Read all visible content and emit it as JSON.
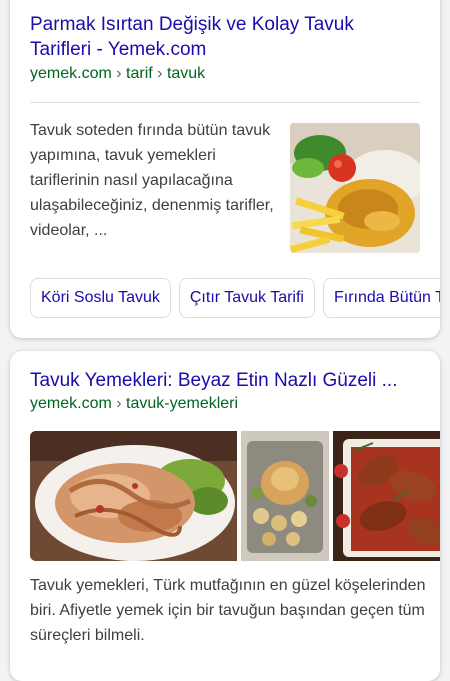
{
  "results": [
    {
      "title": "Parmak Isırtan Değişik ve Kolay Tavuk Tarifleri - Yemek.com",
      "url": {
        "domain": "yemek.com",
        "path1": "tarif",
        "path2": "tavuk"
      },
      "snippet": "Tavuk soteden fırında bütün tavuk yapımına, tavuk yemekleri tariflerinin nasıl yapılacağına ulaşabileceğiniz, denenmiş tarifler, videolar, ...",
      "chips": [
        "Köri Soslu Tavuk",
        "Çıtır Tavuk Tarifi",
        "Fırında Bütün Tavuk"
      ]
    },
    {
      "title": "Tavuk Yemekleri: Beyaz Etin Nazlı Güzeli ...",
      "url": {
        "domain": "yemek.com",
        "path1": "tavuk-yemekleri"
      },
      "snippet": "Tavuk yemekleri, Türk mutfağının en güzel köşelerinden biri. Afiyetle yemek için bir tavuğun başından geçen tüm süreçleri bilmeli."
    }
  ],
  "colors": {
    "link": "#1a0dab",
    "url": "#006621",
    "text": "#3c4043",
    "background": "#f1f3f4"
  }
}
